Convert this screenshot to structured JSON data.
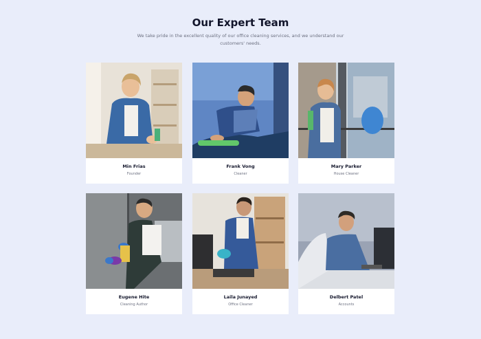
{
  "section": {
    "title": "Our Expert Team",
    "subtitle": "We take pride in the excellent quality of our office cleaning services, and we understand our customers' needs."
  },
  "team": [
    {
      "name": "Min Frias",
      "role": "Founder"
    },
    {
      "name": "Frank Vong",
      "role": "Cleaner"
    },
    {
      "name": "Mary Parker",
      "role": "House Cleaner"
    },
    {
      "name": "Eugene Hite",
      "role": "Cleaning Author"
    },
    {
      "name": "Laila Junayed",
      "role": "Office Cleaner"
    },
    {
      "name": "Delbert Patel",
      "role": "Accounts"
    }
  ],
  "colors": {
    "background": "#e9edfa",
    "card": "#ffffff",
    "heading": "#12152b",
    "muted": "#6c7080"
  }
}
